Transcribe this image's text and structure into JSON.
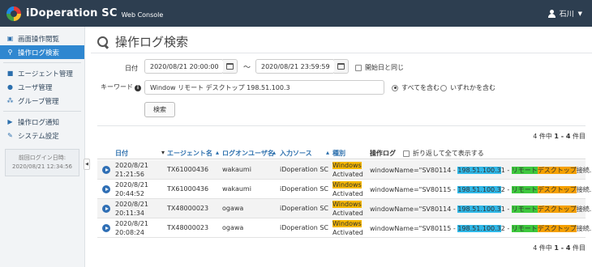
{
  "header": {
    "app_name": "iDoperation SC",
    "app_subtitle": "Web Console",
    "user_name": "石川"
  },
  "sidebar": {
    "items": [
      {
        "label": "画面操作閲覧",
        "icon": "screen-icon"
      },
      {
        "label": "操作ログ検索",
        "icon": "search-icon",
        "active": true
      },
      {
        "label": "エージェント管理",
        "icon": "camera-icon"
      },
      {
        "label": "ユーザ管理",
        "icon": "user-icon"
      },
      {
        "label": "グループ管理",
        "icon": "users-icon"
      },
      {
        "label": "操作ログ通知",
        "icon": "notify-icon"
      },
      {
        "label": "システム設定",
        "icon": "wrench-icon"
      }
    ],
    "last_login_label": "前回ログイン日時:",
    "last_login_value": "2020/08/21 12:34:56"
  },
  "page": {
    "title": "操作ログ検索"
  },
  "form": {
    "date_label": "日付",
    "date_from": "2020/08/21 20:00:00",
    "date_sep": "～",
    "date_to": "2020/08/21 23:59:59",
    "same_day_label": "開始日と同じ",
    "keyword_label": "キーワード",
    "keyword_value": "Window リモート デスクトップ 198.51.100.3",
    "radio_all_label": "すべてを含む",
    "radio_any_label": "いずれかを含む",
    "search_button": "検索"
  },
  "results": {
    "count_text_top": {
      "prefix": "4 件中 ",
      "range": "1 - 4",
      "suffix": " 件目"
    },
    "count_text_bottom": {
      "prefix": "4 件中 ",
      "range": "1 - 4",
      "suffix": " 件目"
    },
    "columns": {
      "date": "日付",
      "agent": "エージェント名",
      "logon_user": "ログオンユーザ名",
      "source": "入力ソース",
      "type": "種別",
      "log": "操作ログ",
      "wrap_label": "折り返して全て表示する"
    },
    "rows": [
      {
        "date1": "2020/8/21",
        "date2": "21:21:56",
        "agent": "TX61000436",
        "user": "wakaumi",
        "source": "iDoperation SC",
        "type1": "Windows",
        "type2": "Activated",
        "log_pre": "windowName=\"SV80114 - ",
        "log_ip": "198.51.100.3",
        "log_mid1": "1 - ",
        "log_remote": "リモート",
        "log_desk": "デスクトップ",
        "log_post": "接続..."
      },
      {
        "date1": "2020/8/21",
        "date2": "20:44:52",
        "agent": "TX61000436",
        "user": "wakaumi",
        "source": "iDoperation SC",
        "type1": "Windows",
        "type2": "Activated",
        "log_pre": "windowName=\"SV80115 - ",
        "log_ip": "198.51.100.3",
        "log_mid1": "2 - ",
        "log_remote": "リモート",
        "log_desk": "デスクトップ",
        "log_post": "接続..."
      },
      {
        "date1": "2020/8/21",
        "date2": "20:11:34",
        "agent": "TX48000023",
        "user": "ogawa",
        "source": "iDoperation SC",
        "type1": "Windows",
        "type2": "Activated",
        "log_pre": "windowName=\"SV80114 - ",
        "log_ip": "198.51.100.3",
        "log_mid1": "1 - ",
        "log_remote": "リモート",
        "log_desk": "デスクトップ",
        "log_post": "接続..."
      },
      {
        "date1": "2020/8/21",
        "date2": "20:08:24",
        "agent": "TX48000023",
        "user": "ogawa",
        "source": "iDoperation SC",
        "type1": "Windows",
        "type2": "Activated",
        "log_pre": "windowName=\"SV80115 - ",
        "log_ip": "198.51.100.3",
        "log_mid1": "2 - ",
        "log_remote": "リモート",
        "log_desk": "デスクトップ",
        "log_post": "接続..."
      }
    ]
  },
  "colors": {
    "topbar": "#2d3e50",
    "accent": "#2f87d0",
    "highlight_windows": "#f5b700",
    "highlight_ip": "#2fb8e8",
    "highlight_remote": "#3ec93e",
    "highlight_desktop": "#f5a000"
  }
}
